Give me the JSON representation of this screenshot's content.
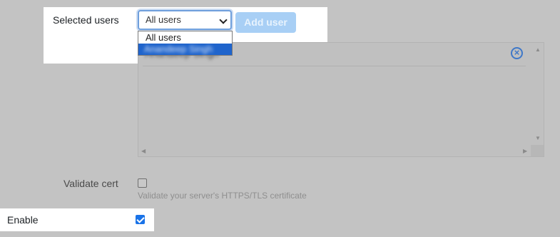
{
  "selected_users": {
    "label": "Selected users",
    "select_value": "All users",
    "add_button_label": "Add user",
    "dropdown_options": [
      "All users",
      "Anandeep Singh"
    ],
    "list_items": [
      "Anandeep Singh"
    ]
  },
  "validate_cert": {
    "label": "Validate cert",
    "checked": false,
    "help_text": "Validate your server's HTTPS/TLS certificate"
  },
  "enable": {
    "label": "Enable",
    "checked": true
  },
  "icons": {
    "remove": "remove-circle-icon",
    "select_chevron": "chevron-down-icon"
  },
  "colors": {
    "accent": "#1a73e8",
    "selected_option": "#1f64cc",
    "add_button": "#a8cff5",
    "overlay": "#c3c3c3"
  }
}
